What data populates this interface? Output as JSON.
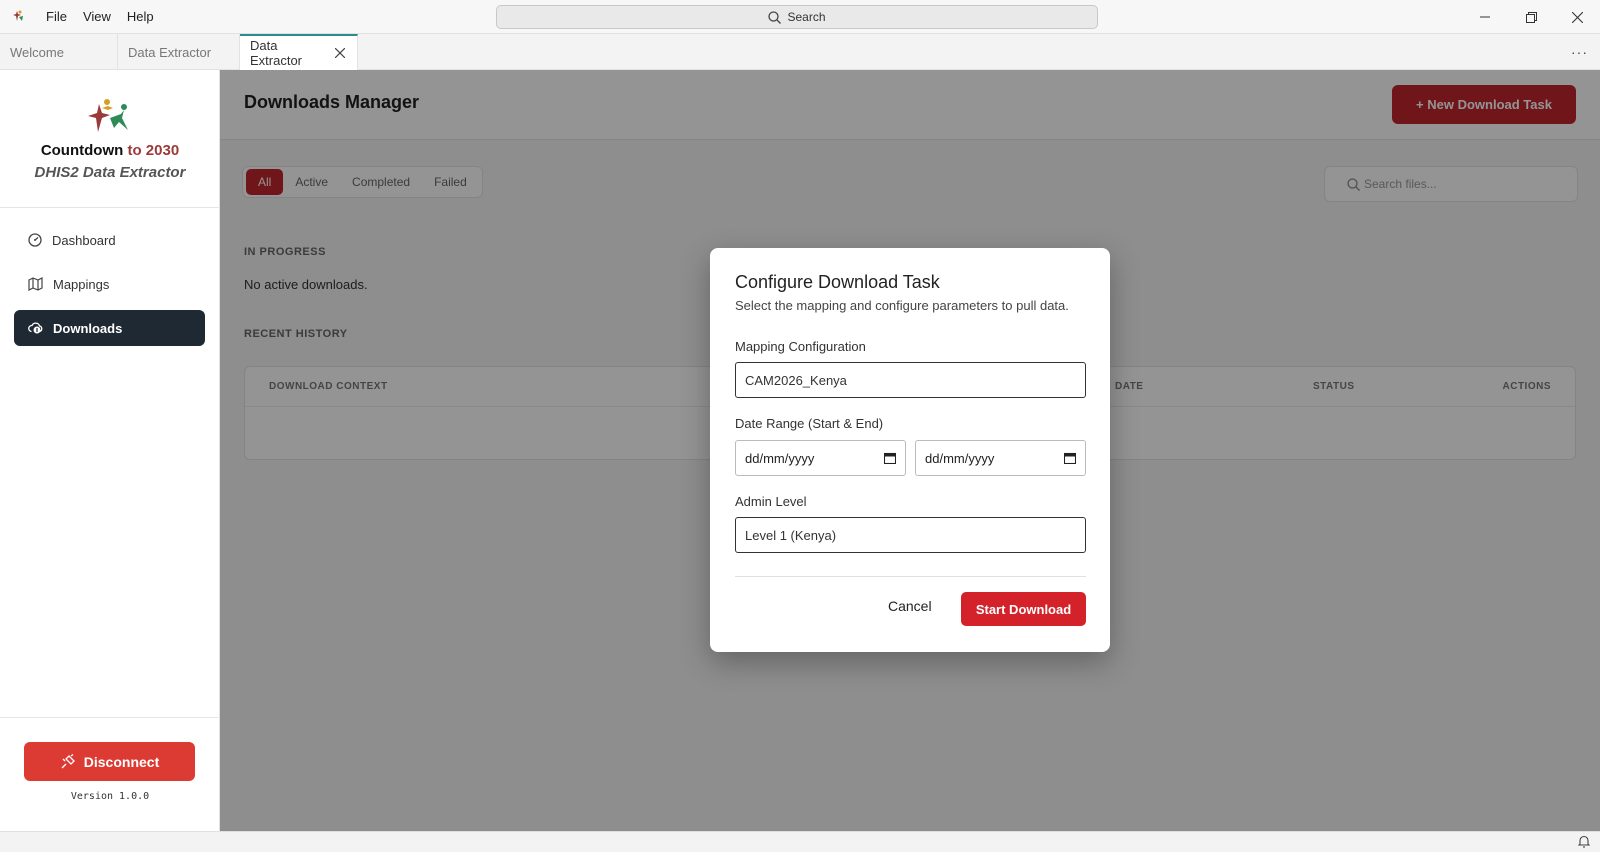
{
  "menu": {
    "file": "File",
    "view": "View",
    "help": "Help"
  },
  "search": {
    "label": "Search"
  },
  "tabs": [
    {
      "label": "Welcome"
    },
    {
      "label": "Data Extractor"
    },
    {
      "label": "Data Extractor"
    }
  ],
  "tab_more": "···",
  "brand": {
    "name_a": "Countdown",
    "name_b": "to 2030",
    "subtitle": "DHIS2 Data Extractor"
  },
  "sidebar": {
    "items": [
      {
        "label": "Dashboard",
        "icon": "gauge-icon"
      },
      {
        "label": "Mappings",
        "icon": "map-icon"
      },
      {
        "label": "Downloads",
        "icon": "cloud-download-icon",
        "active": true
      }
    ],
    "disconnect_label": "Disconnect",
    "version": "Version 1.0.0"
  },
  "main": {
    "title": "Downloads Manager",
    "new_task_label": "+ New Download Task",
    "filters": [
      "All",
      "Active",
      "Completed",
      "Failed"
    ],
    "search_placeholder": "Search files...",
    "in_progress_label": "IN PROGRESS",
    "empty_text": "No active downloads.",
    "recent_history_label": "RECENT HISTORY",
    "columns": [
      "DOWNLOAD CONTEXT",
      "DATE",
      "STATUS",
      "ACTIONS"
    ]
  },
  "modal": {
    "title": "Configure Download Task",
    "subtitle": "Select the mapping and configure parameters to pull data.",
    "mapping_label": "Mapping Configuration",
    "mapping_value": "CAM2026_Kenya",
    "date_label": "Date Range (Start & End)",
    "start_date": "dd/mm/yyyy",
    "end_date": "dd/mm/yyyy",
    "admin_label": "Admin Level",
    "admin_value": "Level 1 (Kenya)",
    "cancel_label": "Cancel",
    "start_label": "Start Download"
  },
  "colors": {
    "accent": "#c2262e",
    "nav_active": "#1f2933",
    "disconnect": "#dc3b33"
  }
}
